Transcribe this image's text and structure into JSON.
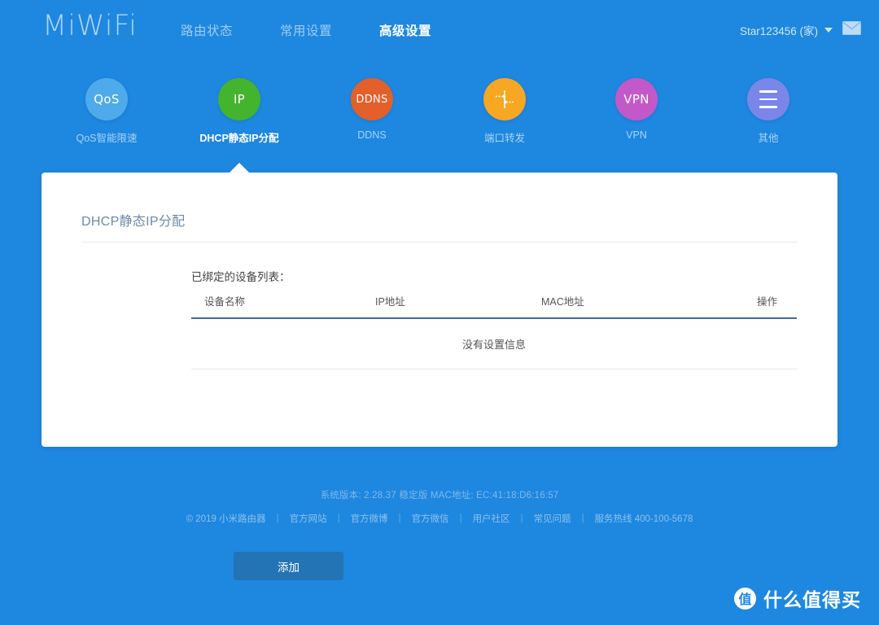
{
  "brand": {
    "logo_text": "MiWiFi"
  },
  "nav": {
    "items": [
      {
        "label": "路由状态",
        "active": false
      },
      {
        "label": "常用设置",
        "active": false
      },
      {
        "label": "高级设置",
        "active": true
      }
    ]
  },
  "user": {
    "name": "Star123456 (家)",
    "chevron_icon": "chevron-down-icon",
    "mail_icon": "envelope-icon"
  },
  "iconbar": {
    "items": [
      {
        "glyph": "QoS",
        "label": "QoS智能限速",
        "color": "#4eaaea",
        "active": false,
        "icon_name": "qos-icon"
      },
      {
        "glyph": "IP",
        "label": "DHCP静态IP分配",
        "color": "#44b32e",
        "active": true,
        "icon_name": "dhcp-ip-icon"
      },
      {
        "glyph": "DDNS",
        "label": "DDNS",
        "color": "#e3602a",
        "active": false,
        "icon_name": "ddns-icon"
      },
      {
        "glyph": "",
        "label": "端口转发",
        "color": "#f7a721",
        "active": false,
        "icon_name": "port-forward-icon"
      },
      {
        "glyph": "VPN",
        "label": "VPN",
        "color": "#c359c8",
        "active": false,
        "icon_name": "vpn-icon"
      },
      {
        "glyph": "",
        "label": "其他",
        "color": "#7a86e8",
        "active": false,
        "icon_name": "more-menu-icon"
      }
    ]
  },
  "card": {
    "title": "DHCP静态IP分配",
    "section_label": "已绑定的设备列表：",
    "table": {
      "headers": [
        "设备名称",
        "IP地址",
        "MAC地址",
        "操作"
      ],
      "rows": [],
      "empty_text": "没有设置信息"
    },
    "add_button": "添加"
  },
  "footer": {
    "version_line": "系统版本: 2.28.37 稳定版  MAC地址: EC:41:18:D6:16:57",
    "copyright": "© 2019 小米路由器",
    "links": [
      "官方网站",
      "官方微博",
      "官方微信",
      "用户社区",
      "常见问题",
      "服务热线 400-100-5678"
    ],
    "separator": "|"
  },
  "watermark": {
    "badge": "值",
    "text": "什么值得买"
  },
  "colors": {
    "background": "#1e87e0",
    "card": "#ffffff",
    "accent_button": "#2274b5",
    "table_rule": "#3c6e9e"
  }
}
